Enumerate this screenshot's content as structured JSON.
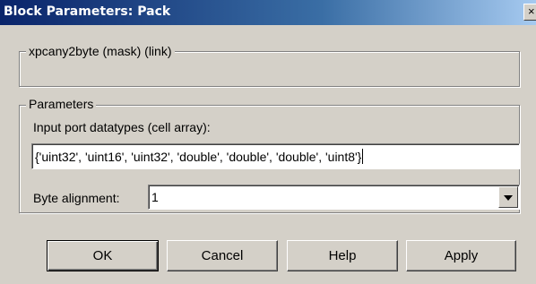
{
  "window": {
    "title": "Block Parameters: Pack",
    "close_glyph": "×"
  },
  "mask_group": {
    "label": "xpcany2byte (mask) (link)"
  },
  "parameters": {
    "group_label": "Parameters",
    "datatypes_caption": "Input port datatypes (cell array):",
    "datatypes_value": "{'uint32', 'uint16', 'uint32', 'double', 'double', 'double', 'uint8'}",
    "byte_alignment_caption": "Byte alignment:",
    "byte_alignment_value": "1"
  },
  "buttons": {
    "ok": "OK",
    "cancel": "Cancel",
    "help": "Help",
    "apply": "Apply"
  },
  "icons": {
    "close": "close-icon",
    "dropdown": "chevron-down-icon"
  }
}
